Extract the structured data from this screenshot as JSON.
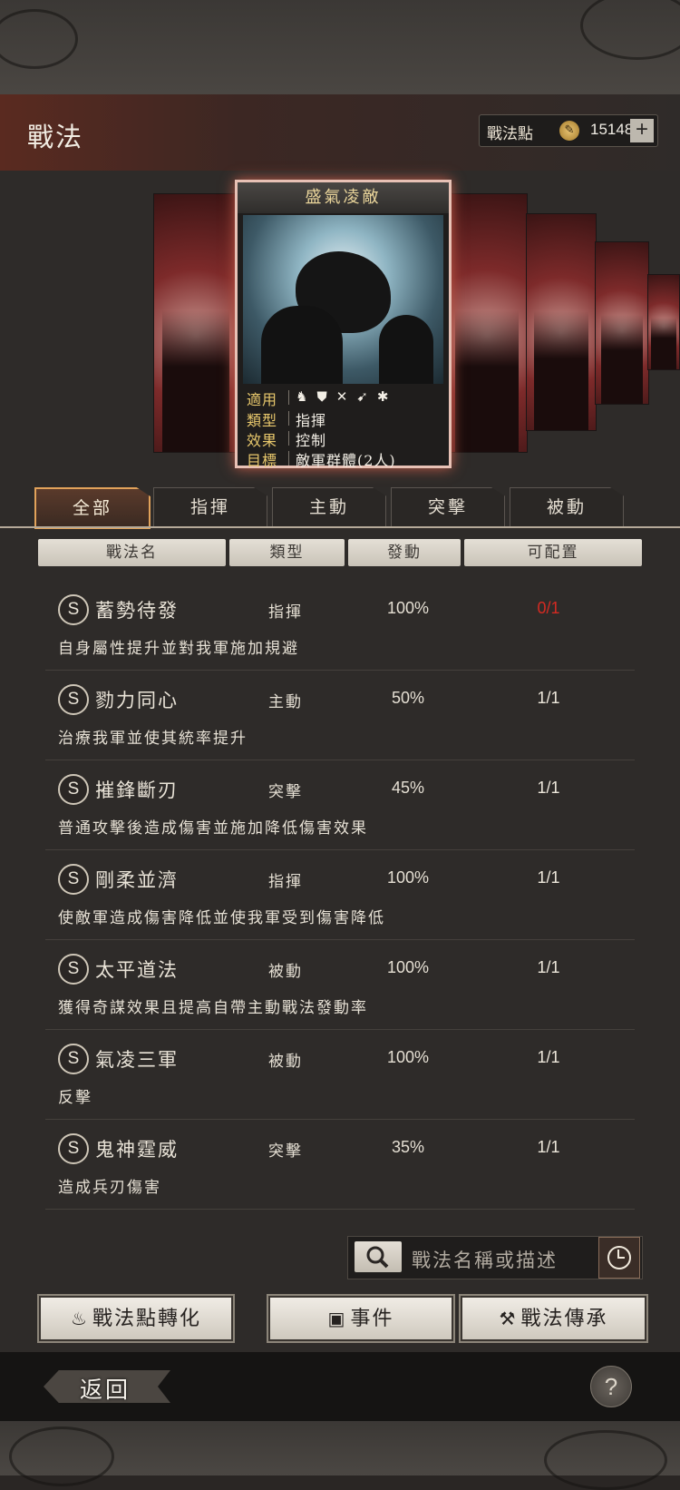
{
  "header": {
    "title": "戰法",
    "points_label": "戰法點",
    "points_value": "15148",
    "plus": "+"
  },
  "card": {
    "title": "盛氣凌敵",
    "applicable_label": "適用",
    "applicable_icons": [
      "cavalry-icon",
      "shield-icon",
      "crossbow-icon",
      "spear-icon",
      "chariot-icon"
    ],
    "type_label": "類型",
    "type_value": "指揮",
    "effect_label": "效果",
    "effect_value": "控制",
    "target_label": "目標",
    "target_value": "敵軍群體(2人)"
  },
  "tabs": [
    "全部",
    "指揮",
    "主動",
    "突擊",
    "被動"
  ],
  "columns": [
    "戰法名",
    "類型",
    "發動",
    "可配置"
  ],
  "skills": [
    {
      "grade": "S",
      "name": "蓄勢待發",
      "type": "指揮",
      "rate": "100%",
      "slots": "0/1",
      "desc": "自身屬性提升並對我軍施加規避"
    },
    {
      "grade": "S",
      "name": "勠力同心",
      "type": "主動",
      "rate": "50%",
      "slots": "1/1",
      "desc": "治療我軍並使其統率提升"
    },
    {
      "grade": "S",
      "name": "摧鋒斷刃",
      "type": "突擊",
      "rate": "45%",
      "slots": "1/1",
      "desc": "普通攻擊後造成傷害並施加降低傷害效果"
    },
    {
      "grade": "S",
      "name": "剛柔並濟",
      "type": "指揮",
      "rate": "100%",
      "slots": "1/1",
      "desc": "使敵軍造成傷害降低並使我軍受到傷害降低"
    },
    {
      "grade": "S",
      "name": "太平道法",
      "type": "被動",
      "rate": "100%",
      "slots": "1/1",
      "desc": "獲得奇謀效果且提高自帶主動戰法發動率"
    },
    {
      "grade": "S",
      "name": "氣凌三軍",
      "type": "被動",
      "rate": "100%",
      "slots": "1/1",
      "desc": "反擊"
    },
    {
      "grade": "S",
      "name": "鬼神霆威",
      "type": "突擊",
      "rate": "35%",
      "slots": "1/1",
      "desc": "造成兵刃傷害"
    }
  ],
  "search": {
    "placeholder": "戰法名稱或描述"
  },
  "buttons": {
    "convert": "戰法點轉化",
    "event": "事件",
    "inherit": "戰法傳承"
  },
  "footer": {
    "back": "返回",
    "help": "?"
  },
  "colors": {
    "accent": "#e1a25a",
    "unavailable": "#d42a22"
  }
}
